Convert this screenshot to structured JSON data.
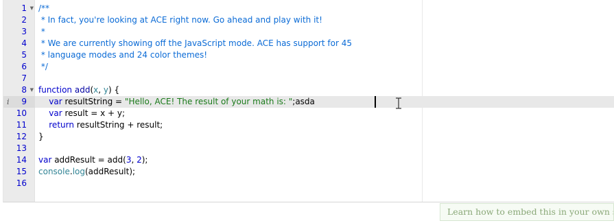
{
  "editor": {
    "active_line": 9,
    "gutter": [
      {
        "n": "1",
        "fold": true
      },
      {
        "n": "2"
      },
      {
        "n": "3"
      },
      {
        "n": "4"
      },
      {
        "n": "5"
      },
      {
        "n": "6"
      },
      {
        "n": "7"
      },
      {
        "n": "8",
        "fold": true
      },
      {
        "n": "9",
        "info": "i"
      },
      {
        "n": "10"
      },
      {
        "n": "11"
      },
      {
        "n": "12"
      },
      {
        "n": "13"
      },
      {
        "n": "14"
      },
      {
        "n": "15"
      },
      {
        "n": "16"
      }
    ],
    "lines": [
      [
        {
          "t": "/**",
          "c": "cmt-blue"
        }
      ],
      [
        {
          "t": " * In fact, you're looking at ACE right now. Go ahead and play with it!",
          "c": "cmt-blue"
        }
      ],
      [
        {
          "t": " *",
          "c": "cmt-blue"
        }
      ],
      [
        {
          "t": " * We are currently showing off the JavaScript mode. ACE has support for 45",
          "c": "cmt-blue"
        }
      ],
      [
        {
          "t": " * language modes and 24 color themes!",
          "c": "cmt-blue"
        }
      ],
      [
        {
          "t": " */",
          "c": "cmt-blue"
        }
      ],
      [],
      [
        {
          "t": "function",
          "c": "kw"
        },
        {
          "t": " "
        },
        {
          "t": "add",
          "c": "fn"
        },
        {
          "t": "("
        },
        {
          "t": "x",
          "c": "par"
        },
        {
          "t": ", "
        },
        {
          "t": "y",
          "c": "par"
        },
        {
          "t": ") {"
        }
      ],
      [
        {
          "t": "    "
        },
        {
          "t": "var",
          "c": "kw"
        },
        {
          "t": " resultString = "
        },
        {
          "t": "\"Hello, ACE! The result of your math is: \"",
          "c": "str"
        },
        {
          "t": ";asda"
        }
      ],
      [
        {
          "t": "    "
        },
        {
          "t": "var",
          "c": "kw"
        },
        {
          "t": " result = x + y;"
        }
      ],
      [
        {
          "t": "    "
        },
        {
          "t": "return",
          "c": "kw"
        },
        {
          "t": " resultString + result;"
        }
      ],
      [
        {
          "t": "}"
        }
      ],
      [],
      [
        {
          "t": "var",
          "c": "kw"
        },
        {
          "t": " addResult = add("
        },
        {
          "t": "3",
          "c": "num"
        },
        {
          "t": ", "
        },
        {
          "t": "2",
          "c": "num"
        },
        {
          "t": ");"
        }
      ],
      [
        {
          "t": "console",
          "c": "obj"
        },
        {
          "t": "."
        },
        {
          "t": "log",
          "c": "obj"
        },
        {
          "t": "(addResult);"
        }
      ],
      []
    ]
  },
  "footer": {
    "embed_link": "Learn how to embed this in your own site"
  }
}
